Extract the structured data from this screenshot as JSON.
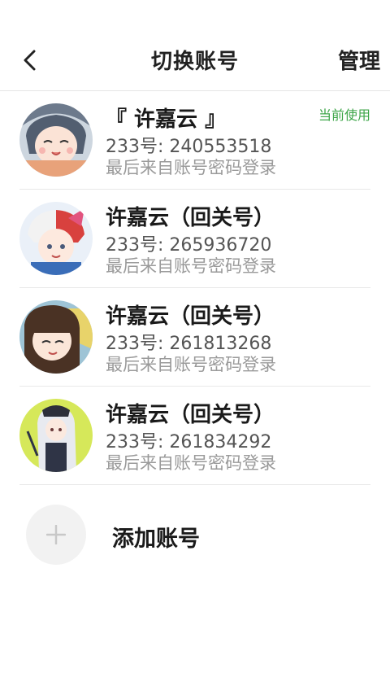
{
  "header": {
    "back_icon": "chevron-left-icon",
    "title": "切换账号",
    "manage_label": "管理"
  },
  "accounts": [
    {
      "name": "『 许嘉云 』",
      "id_text": "233号: 240553518",
      "login_method": "最后来自账号密码登录",
      "badge": "当前使用",
      "avatar_color": "#c9d3de"
    },
    {
      "name": "许嘉云（回关号）",
      "id_text": "233号: 265936720",
      "login_method": "最后来自账号密码登录",
      "avatar_color": "#e9eef6"
    },
    {
      "name": "许嘉云（回关号）",
      "id_text": "233号: 261813268",
      "login_method": "最后来自账号密码登录",
      "avatar_color": "#d9c48a"
    },
    {
      "name": "许嘉云（回关号）",
      "id_text": "233号: 261834292",
      "login_method": "最后来自账号密码登录",
      "avatar_color": "#d8e85a"
    }
  ],
  "add_account": {
    "label": "添加账号",
    "icon": "plus-icon"
  },
  "colors": {
    "accent_green": "#3fa64a",
    "divider": "#e8e8e8",
    "secondary_text": "#9a9a9a"
  }
}
